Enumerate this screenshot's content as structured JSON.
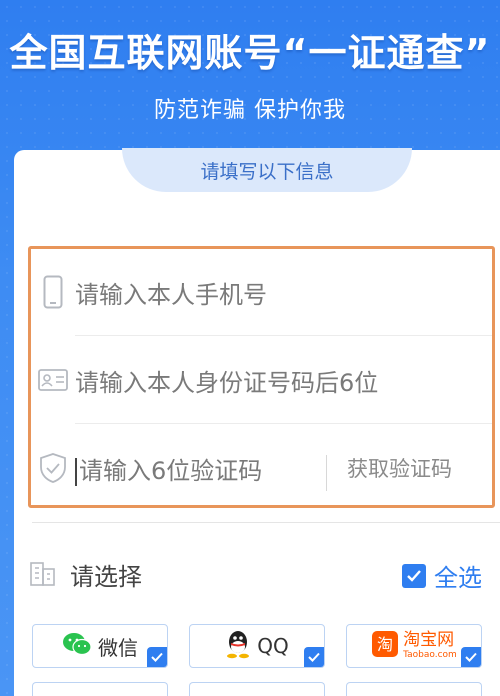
{
  "header": {
    "headline": "全国互联网账号“一证通查”",
    "subhead": "防范诈骗 保护你我"
  },
  "card": {
    "tab_label": "请填写以下信息"
  },
  "form": {
    "phone_placeholder": "请输入本人手机号",
    "id_placeholder": "请输入本人身份证号码后6位",
    "code_placeholder": "请输入6位验证码",
    "get_code_label": "获取验证码"
  },
  "selection": {
    "label": "请选择",
    "select_all_label": "全选",
    "select_all_checked": true
  },
  "apps": [
    {
      "name": "微信",
      "icon": "wechat-icon",
      "checked": true
    },
    {
      "name": "QQ",
      "icon": "qq-icon",
      "checked": true
    },
    {
      "name": "淘宝网",
      "sub": "Taobao.com",
      "icon": "taobao-icon",
      "checked": true
    }
  ],
  "colors": {
    "brand_blue": "#2f7ef0",
    "highlight_orange": "#e8955a",
    "wechat_green": "#2ac34f",
    "taobao_orange": "#ff5a00"
  }
}
